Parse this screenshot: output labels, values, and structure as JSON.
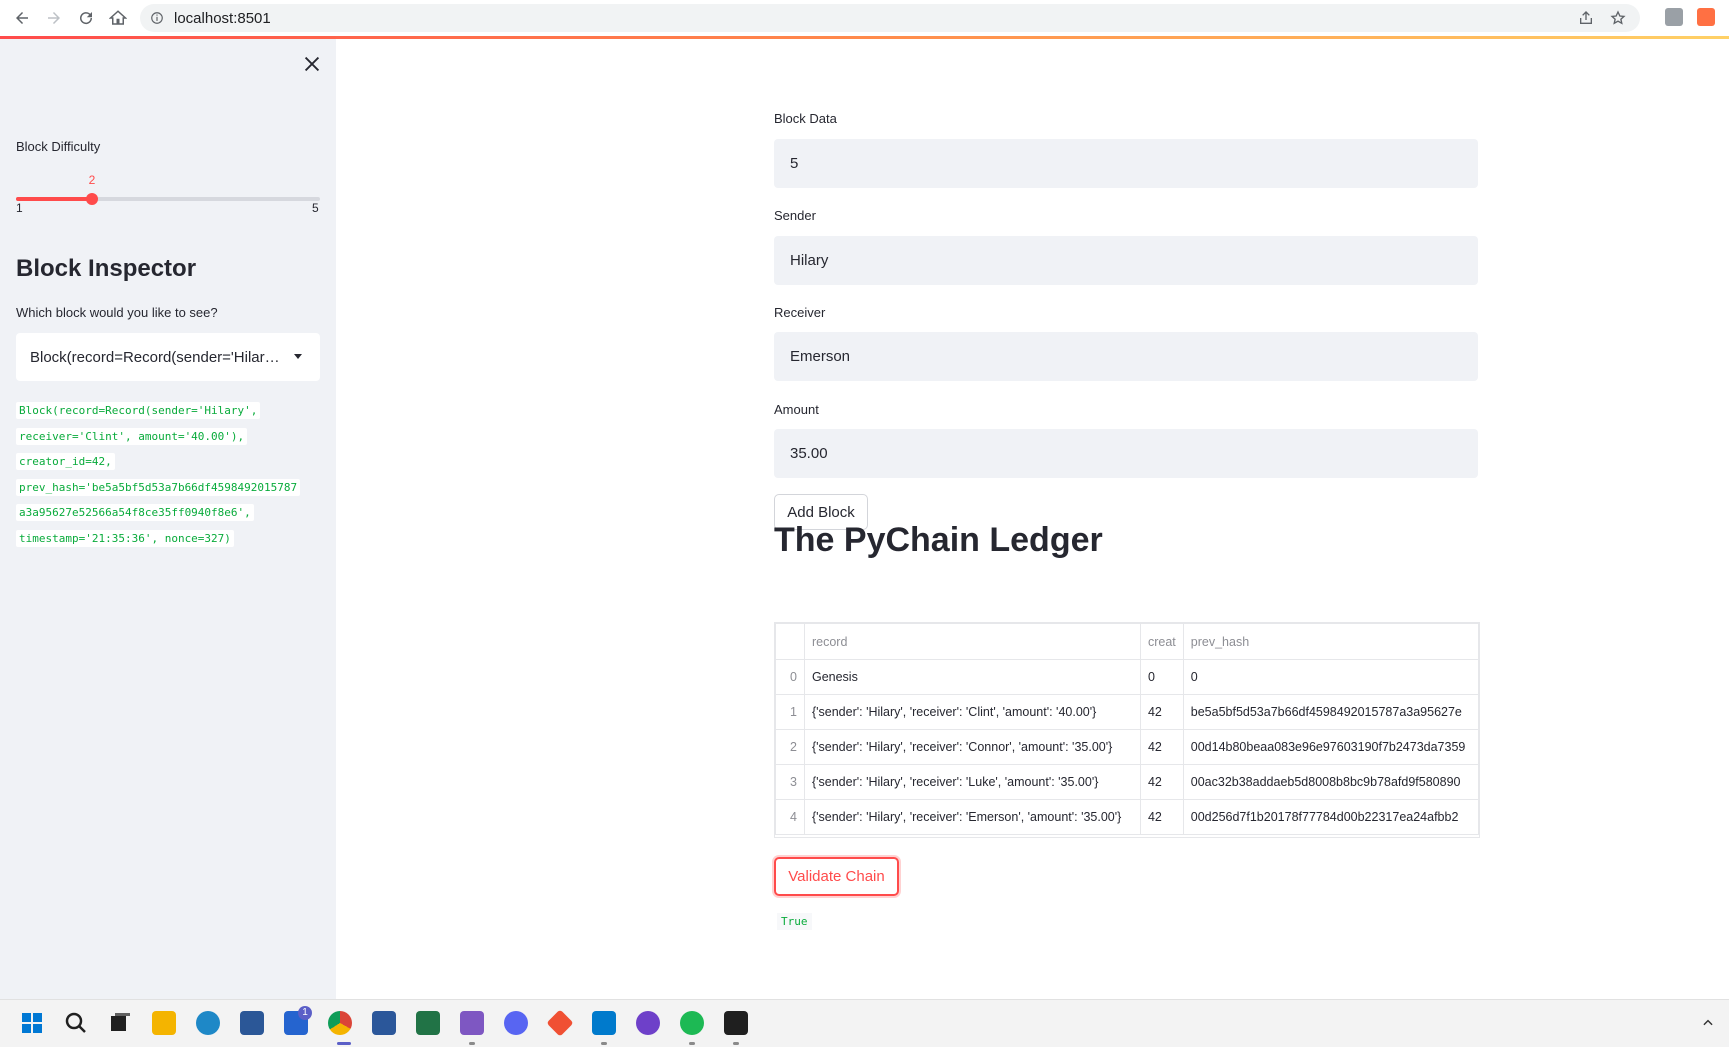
{
  "browser": {
    "url": "localhost:8501"
  },
  "sidebar": {
    "difficulty_label": "Block Difficulty",
    "slider": {
      "value": "2",
      "min": "1",
      "max": "5",
      "fraction": 0.25
    },
    "heading": "Block Inspector",
    "question": "Which block would you like to see?",
    "selected_block": "Block(record=Record(sender='Hilary', receiver='Clint', amount='40.00'), ...",
    "block_detail": [
      "Block(record=Record(sender='Hilary',",
      "receiver='Clint', amount='40.00'),",
      "creator_id=42,",
      "prev_hash='be5a5bf5d53a7b66df4598492015787",
      "a3a95627e52566a54f8ce35ff0940f8e6',",
      "timestamp='21:35:36', nonce=327)"
    ]
  },
  "form": {
    "block_data_label": "Block Data",
    "block_data_value": "5",
    "sender_label": "Sender",
    "sender_value": "Hilary",
    "receiver_label": "Receiver",
    "receiver_value": "Emerson",
    "amount_label": "Amount",
    "amount_value": "35.00",
    "add_block_label": "Add Block"
  },
  "ledger": {
    "title": "The PyChain Ledger",
    "columns": [
      "",
      "record",
      "creat",
      "prev_hash"
    ],
    "rows": [
      [
        "0",
        "Genesis",
        "0",
        "0"
      ],
      [
        "1",
        "{'sender': 'Hilary', 'receiver': 'Clint', 'amount': '40.00'}",
        "42",
        "be5a5bf5d53a7b66df4598492015787a3a95627e"
      ],
      [
        "2",
        "{'sender': 'Hilary', 'receiver': 'Connor', 'amount': '35.00'}",
        "42",
        "00d14b80beaa083e96e97603190f7b2473da7359"
      ],
      [
        "3",
        "{'sender': 'Hilary', 'receiver': 'Luke', 'amount': '35.00'}",
        "42",
        "00ac32b38addaeb5d8008b8bc9b78afd9f580890"
      ],
      [
        "4",
        "{'sender': 'Hilary', 'receiver': 'Emerson', 'amount': '35.00'}",
        "42",
        "00d256d7f1b20178f77784d00b22317ea24afbb2"
      ]
    ]
  },
  "validate": {
    "button_label": "Validate Chain",
    "result": "True"
  },
  "taskbar": {
    "icons": [
      "windows-start-icon",
      "search-icon",
      "task-view-icon",
      "file-explorer-icon",
      "edge-icon",
      "store-icon",
      "todo-icon",
      "chrome-icon",
      "word-icon",
      "excel-icon",
      "app-icon",
      "discord-icon",
      "git-icon",
      "vscode-icon",
      "github-desktop-icon",
      "spotify-icon",
      "terminal-icon"
    ],
    "todo_badge": "1"
  },
  "colors": {
    "accent": "#ff4b4b",
    "code_green": "#09ab3b",
    "sidebar_bg": "#f0f2f6"
  }
}
